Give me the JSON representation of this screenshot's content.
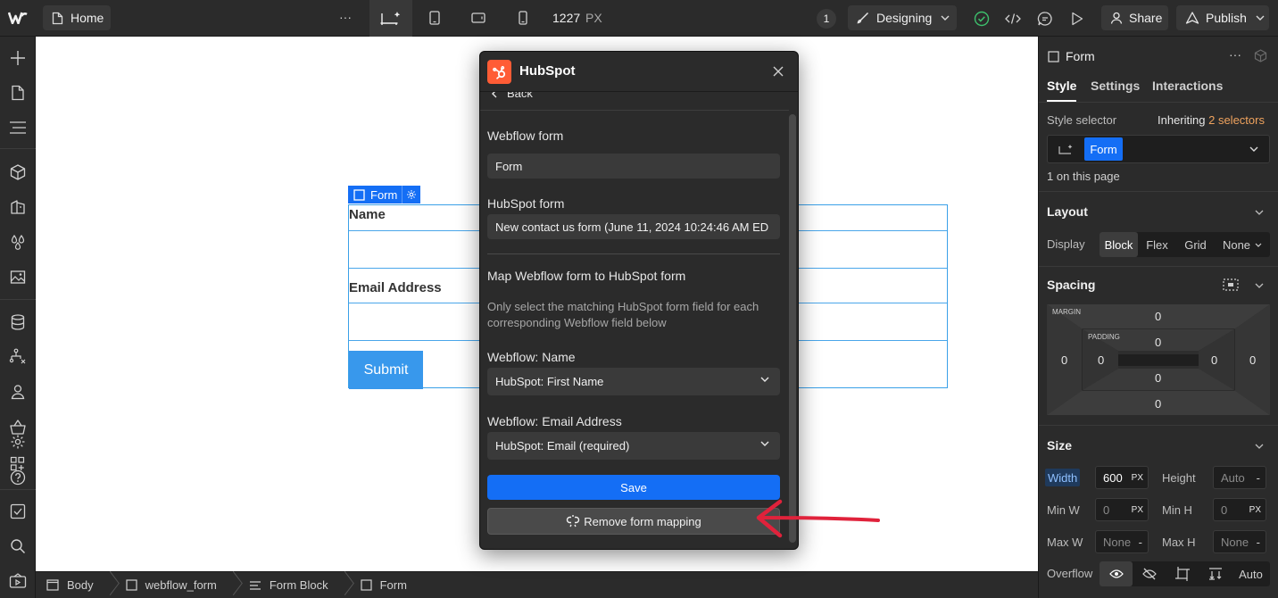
{
  "topbar": {
    "page_name": "Home",
    "more": "···",
    "width_value": "1227",
    "width_unit": "PX",
    "badge_count": "1",
    "mode_label": "Designing",
    "share_label": "Share",
    "publish_label": "Publish"
  },
  "canvas": {
    "form_tag_label": "Form",
    "name_label": "Name",
    "email_label": "Email Address",
    "submit_label": "Submit"
  },
  "modal": {
    "title": "HubSpot",
    "back_label": "Back",
    "webflow_form_label": "Webflow form",
    "webflow_form_value": "Form",
    "hubspot_form_label": "HubSpot form",
    "hubspot_form_value": "New contact us form (June 11, 2024 10:24:46 AM ED",
    "map_heading": "Map Webflow form to HubSpot form",
    "map_help": "Only select the matching HubSpot form field for each corresponding Webflow field below",
    "field1_label": "Webflow: Name",
    "field1_value": "HubSpot: First Name",
    "field2_label": "Webflow: Email Address",
    "field2_value": "HubSpot: Email (required)",
    "save_label": "Save",
    "remove_label": "Remove form mapping"
  },
  "breadcrumbs": [
    {
      "label": "Body"
    },
    {
      "label": "webflow_form"
    },
    {
      "label": "Form Block"
    },
    {
      "label": "Form"
    }
  ],
  "panel": {
    "element_name": "Form",
    "tabs": [
      "Style",
      "Settings",
      "Interactions"
    ],
    "style_selector_label": "Style selector",
    "inheriting_prefix": "Inheriting",
    "inheriting_count": "2 selectors",
    "selector_chip": "Form",
    "on_page": "1 on this page",
    "layout_title": "Layout",
    "display_label": "Display",
    "display_options": [
      "Block",
      "Flex",
      "Grid",
      "None"
    ],
    "spacing_title": "Spacing",
    "margin_label": "MARGIN",
    "padding_label": "PADDING",
    "margin": {
      "top": "0",
      "right": "0",
      "bottom": "0",
      "left": "0"
    },
    "padding": {
      "top": "0",
      "right": "0",
      "bottom": "0",
      "left": "0"
    },
    "size_title": "Size",
    "width_label": "Width",
    "width_value": "600",
    "width_unit": "PX",
    "height_label": "Height",
    "height_value": "Auto",
    "minw_label": "Min W",
    "minw_value": "0",
    "minw_unit": "PX",
    "minh_label": "Min H",
    "minh_value": "0",
    "minh_unit": "PX",
    "maxw_label": "Max W",
    "maxw_value": "None",
    "maxh_label": "Max H",
    "maxh_value": "None",
    "overflow_label": "Overflow",
    "overflow_auto": "Auto",
    "dash": "-"
  },
  "colors": {
    "accent_blue": "#146ef5",
    "inherit_orange": "#f0a35e",
    "arrow_red": "#e0223b",
    "hubspot_orange": "#ff5c35"
  }
}
